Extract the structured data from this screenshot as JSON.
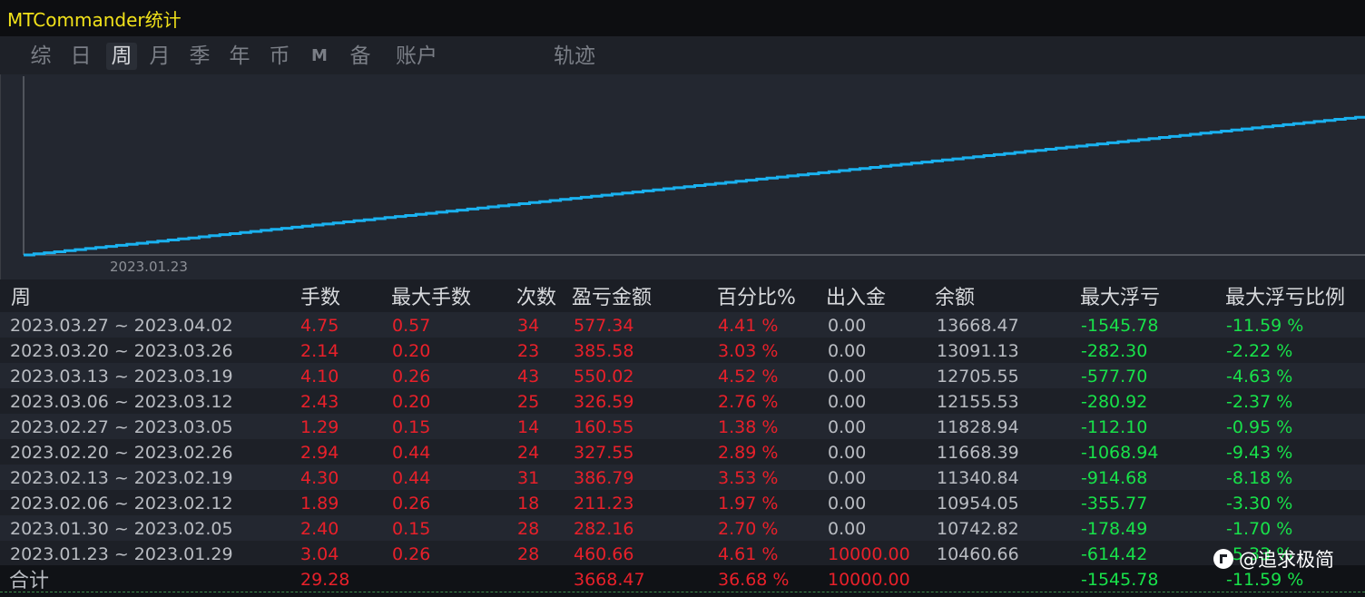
{
  "app": {
    "title": "MTCommander统计"
  },
  "tabs": [
    {
      "label": "综",
      "active": false
    },
    {
      "label": "日",
      "active": false
    },
    {
      "label": "周",
      "active": true
    },
    {
      "label": "月",
      "active": false
    },
    {
      "label": "季",
      "active": false
    },
    {
      "label": "年",
      "active": false
    },
    {
      "label": "币",
      "active": false
    },
    {
      "label": "M",
      "active": false
    },
    {
      "label": "备",
      "active": false
    },
    {
      "label": "账户",
      "active": false
    },
    {
      "label": "轨迹",
      "active": false
    }
  ],
  "chart_data": {
    "type": "line",
    "x_tick_labels": [
      "2023.01.23"
    ],
    "line_color": "#1ab2f0",
    "trend": "steadily increasing stepped balance curve"
  },
  "table": {
    "headers": [
      "周",
      "手数",
      "最大手数",
      "次数",
      "盈亏金额",
      "百分比%",
      "出入金",
      "余额",
      "最大浮亏",
      "最大浮亏比例"
    ],
    "rows": [
      [
        "2023.03.27 ~ 2023.04.02",
        "4.75",
        "0.57",
        "34",
        "577.34",
        "4.41 %",
        "0.00",
        "13668.47",
        "-1545.78",
        "-11.59 %"
      ],
      [
        "2023.03.20 ~ 2023.03.26",
        "2.14",
        "0.20",
        "23",
        "385.58",
        "3.03 %",
        "0.00",
        "13091.13",
        "-282.30",
        "-2.22 %"
      ],
      [
        "2023.03.13 ~ 2023.03.19",
        "4.10",
        "0.26",
        "43",
        "550.02",
        "4.52 %",
        "0.00",
        "12705.55",
        "-577.70",
        "-4.63 %"
      ],
      [
        "2023.03.06 ~ 2023.03.12",
        "2.43",
        "0.20",
        "25",
        "326.59",
        "2.76 %",
        "0.00",
        "12155.53",
        "-280.92",
        "-2.37 %"
      ],
      [
        "2023.02.27 ~ 2023.03.05",
        "1.29",
        "0.15",
        "14",
        "160.55",
        "1.38 %",
        "0.00",
        "11828.94",
        "-112.10",
        "-0.95 %"
      ],
      [
        "2023.02.20 ~ 2023.02.26",
        "2.94",
        "0.44",
        "24",
        "327.55",
        "2.89 %",
        "0.00",
        "11668.39",
        "-1068.94",
        "-9.43 %"
      ],
      [
        "2023.02.13 ~ 2023.02.19",
        "4.30",
        "0.44",
        "31",
        "386.79",
        "3.53 %",
        "0.00",
        "11340.84",
        "-914.68",
        "-8.18 %"
      ],
      [
        "2023.02.06 ~ 2023.02.12",
        "1.89",
        "0.26",
        "18",
        "211.23",
        "1.97 %",
        "0.00",
        "10954.05",
        "-355.77",
        "-3.30 %"
      ],
      [
        "2023.01.30 ~ 2023.02.05",
        "2.40",
        "0.15",
        "28",
        "282.16",
        "2.70 %",
        "0.00",
        "10742.82",
        "-178.49",
        "-1.70 %"
      ],
      [
        "2023.01.23 ~ 2023.01.29",
        "3.04",
        "0.26",
        "28",
        "460.66",
        "4.61 %",
        "10000.00",
        "10460.66",
        "-614.42",
        "-5.33 %"
      ]
    ],
    "total": [
      "合计",
      "29.28",
      "",
      "",
      "3668.47",
      "36.68 %",
      "10000.00",
      "",
      "-1545.78",
      "-11.59 %"
    ]
  },
  "colors": {
    "positive": "#e8202a",
    "negative": "#18e24a",
    "neutral": "#b9bcc2",
    "title": "#f2e21a"
  },
  "watermark": {
    "text": "@追求极简",
    "icon": "toutiao-logo-icon"
  }
}
